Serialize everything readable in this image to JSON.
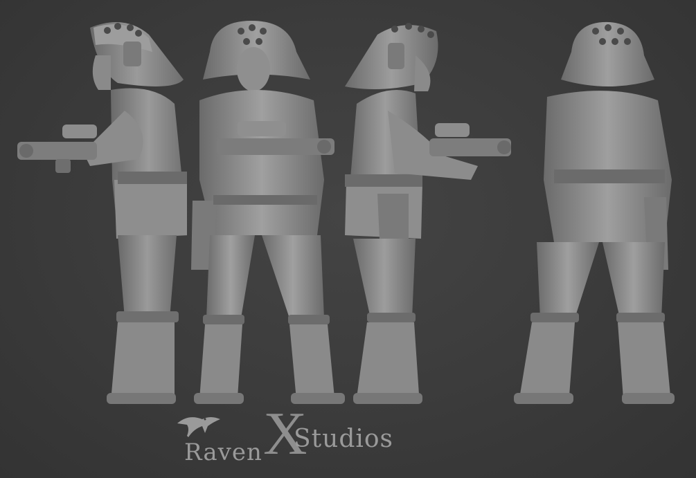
{
  "image": {
    "subject": "",
    "colors": {
      "background": "#3a3a3a",
      "sculpt": "#8a8a8a",
      "sculpt_shadow": "#5e5e5e",
      "logo_text": "#9a9a9a"
    }
  },
  "logo": {
    "word_left": "Raven",
    "letter_mark": "X",
    "word_right": "Studios",
    "icon": "raven-bird-icon"
  }
}
